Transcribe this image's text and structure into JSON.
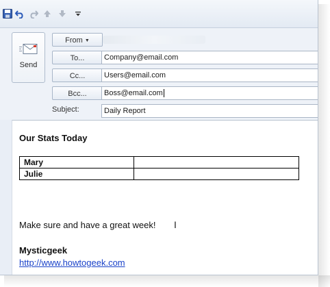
{
  "toolbar": {
    "icons": [
      "save-icon",
      "undo-icon",
      "redo-icon",
      "move-up-icon",
      "move-down-icon",
      "customize-toolbar-icon"
    ]
  },
  "send": {
    "label": "Send"
  },
  "from": {
    "label": "From",
    "value": ""
  },
  "to": {
    "label": "To...",
    "value": "Company@email.com"
  },
  "cc": {
    "label": "Cc...",
    "value": "Users@email.com"
  },
  "bcc": {
    "label": "Bcc...",
    "value": "Boss@email.com"
  },
  "subject": {
    "label": "Subject:",
    "value": "Daily Report"
  },
  "message": {
    "title": "Our Stats Today",
    "table": [
      {
        "name": "Mary",
        "value": ""
      },
      {
        "name": "Julie",
        "value": ""
      }
    ],
    "text": "Make sure and have a great week!",
    "signature": "Mysticgeek",
    "link": "http://www.howtogeek.com"
  }
}
